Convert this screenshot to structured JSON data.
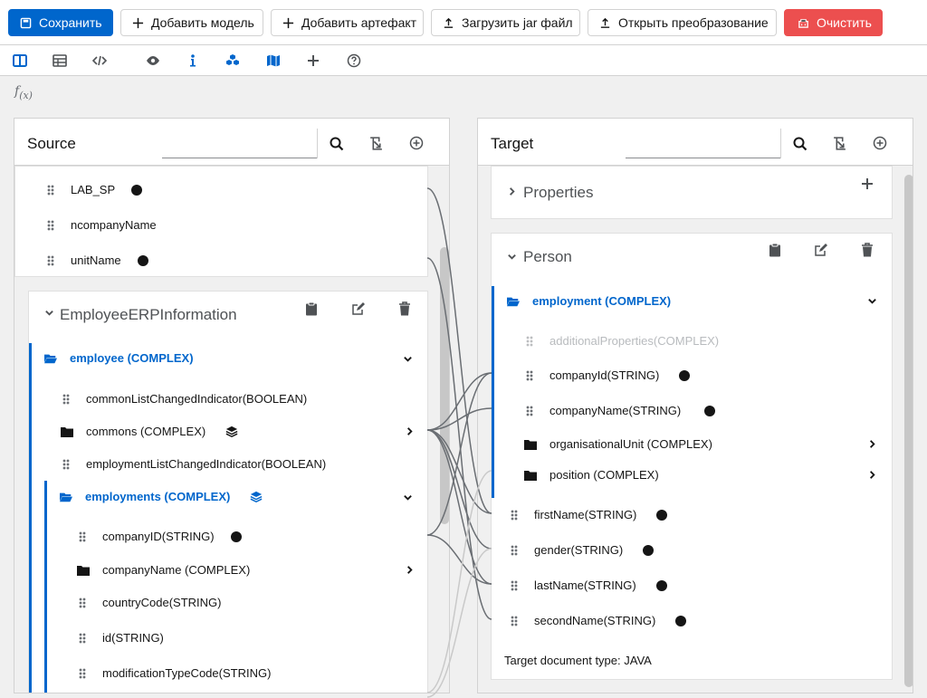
{
  "toolbar": {
    "save": "Сохранить",
    "add_model": "Добавить модель",
    "add_artifact": "Добавить артефакт",
    "upload_jar": "Загрузить jar файл",
    "open_transform": "Открыть преобразование",
    "clear": "Очистить"
  },
  "view_icons": [
    "column-view-icon",
    "table-view-icon",
    "code-view-icon",
    "eye-icon",
    "info-icon",
    "cubes-icon",
    "map-icon",
    "plus-icon",
    "help-icon"
  ],
  "fx": {
    "f": "f",
    "x": "(x)"
  },
  "source": {
    "title": "Source",
    "search_placeholder": "",
    "top_fields": [
      {
        "name": "LAB_SP",
        "mapped": true
      },
      {
        "name": "ncompanyName",
        "mapped": false
      },
      {
        "name": "unitName",
        "mapped": true
      }
    ],
    "doc": {
      "title": "EmployeeERPInformation",
      "employee": "employee (COMPLEX)",
      "commonListChangedIndicator": "commonListChangedIndicator(BOOLEAN)",
      "commons": "commons (COMPLEX)",
      "employmentListChangedIndicator": "employmentListChangedIndicator(BOOLEAN)",
      "employments": "employments (COMPLEX)",
      "companyID": "companyID(STRING)",
      "companyName": "companyName (COMPLEX)",
      "countryCode": "countryCode(STRING)",
      "id": "id(STRING)",
      "modificationTypeCode": "modificationTypeCode(STRING)"
    }
  },
  "target": {
    "title": "Target",
    "search_placeholder": "",
    "properties": "Properties",
    "person": {
      "title": "Person",
      "employment": "employment (COMPLEX)",
      "additionalProperties": "additionalProperties(COMPLEX)",
      "companyId": "companyId(STRING)",
      "companyName": "companyName(STRING)",
      "organisationalUnit": "organisationalUnit (COMPLEX)",
      "position": "position (COMPLEX)",
      "firstName": "firstName(STRING)",
      "gender": "gender(STRING)",
      "lastName": "lastName(STRING)",
      "secondName": "secondName(STRING)"
    },
    "doc_type": "Target document type: JAVA"
  },
  "colors": {
    "primary": "#0066cc",
    "danger": "#ec4f4f",
    "text": "#151515"
  }
}
